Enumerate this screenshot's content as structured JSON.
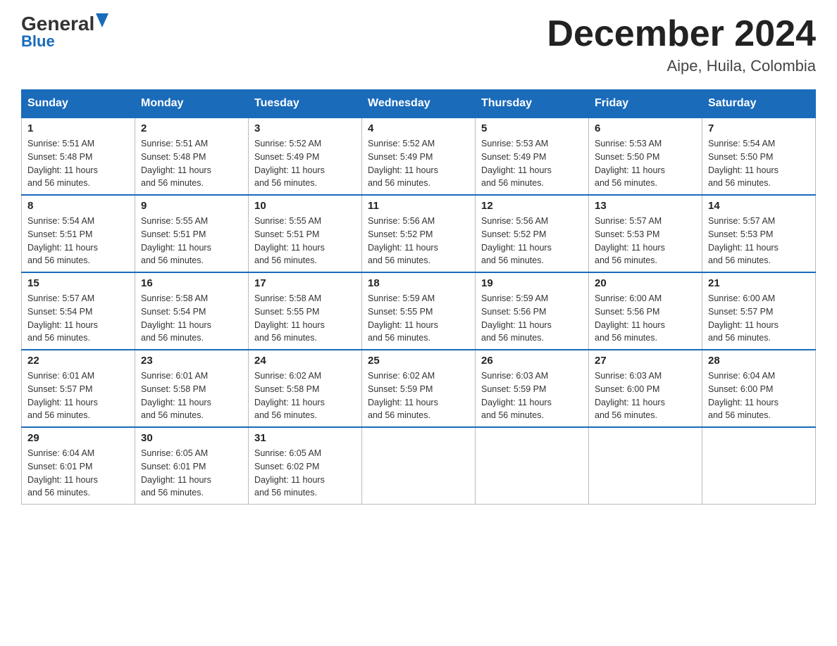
{
  "header": {
    "logo_general": "General",
    "logo_blue": "Blue",
    "month_title": "December 2024",
    "location": "Aipe, Huila, Colombia"
  },
  "weekdays": [
    "Sunday",
    "Monday",
    "Tuesday",
    "Wednesday",
    "Thursday",
    "Friday",
    "Saturday"
  ],
  "weeks": [
    [
      {
        "day": "1",
        "sunrise": "5:51 AM",
        "sunset": "5:48 PM",
        "daylight": "11 hours and 56 minutes."
      },
      {
        "day": "2",
        "sunrise": "5:51 AM",
        "sunset": "5:48 PM",
        "daylight": "11 hours and 56 minutes."
      },
      {
        "day": "3",
        "sunrise": "5:52 AM",
        "sunset": "5:49 PM",
        "daylight": "11 hours and 56 minutes."
      },
      {
        "day": "4",
        "sunrise": "5:52 AM",
        "sunset": "5:49 PM",
        "daylight": "11 hours and 56 minutes."
      },
      {
        "day": "5",
        "sunrise": "5:53 AM",
        "sunset": "5:49 PM",
        "daylight": "11 hours and 56 minutes."
      },
      {
        "day": "6",
        "sunrise": "5:53 AM",
        "sunset": "5:50 PM",
        "daylight": "11 hours and 56 minutes."
      },
      {
        "day": "7",
        "sunrise": "5:54 AM",
        "sunset": "5:50 PM",
        "daylight": "11 hours and 56 minutes."
      }
    ],
    [
      {
        "day": "8",
        "sunrise": "5:54 AM",
        "sunset": "5:51 PM",
        "daylight": "11 hours and 56 minutes."
      },
      {
        "day": "9",
        "sunrise": "5:55 AM",
        "sunset": "5:51 PM",
        "daylight": "11 hours and 56 minutes."
      },
      {
        "day": "10",
        "sunrise": "5:55 AM",
        "sunset": "5:51 PM",
        "daylight": "11 hours and 56 minutes."
      },
      {
        "day": "11",
        "sunrise": "5:56 AM",
        "sunset": "5:52 PM",
        "daylight": "11 hours and 56 minutes."
      },
      {
        "day": "12",
        "sunrise": "5:56 AM",
        "sunset": "5:52 PM",
        "daylight": "11 hours and 56 minutes."
      },
      {
        "day": "13",
        "sunrise": "5:57 AM",
        "sunset": "5:53 PM",
        "daylight": "11 hours and 56 minutes."
      },
      {
        "day": "14",
        "sunrise": "5:57 AM",
        "sunset": "5:53 PM",
        "daylight": "11 hours and 56 minutes."
      }
    ],
    [
      {
        "day": "15",
        "sunrise": "5:57 AM",
        "sunset": "5:54 PM",
        "daylight": "11 hours and 56 minutes."
      },
      {
        "day": "16",
        "sunrise": "5:58 AM",
        "sunset": "5:54 PM",
        "daylight": "11 hours and 56 minutes."
      },
      {
        "day": "17",
        "sunrise": "5:58 AM",
        "sunset": "5:55 PM",
        "daylight": "11 hours and 56 minutes."
      },
      {
        "day": "18",
        "sunrise": "5:59 AM",
        "sunset": "5:55 PM",
        "daylight": "11 hours and 56 minutes."
      },
      {
        "day": "19",
        "sunrise": "5:59 AM",
        "sunset": "5:56 PM",
        "daylight": "11 hours and 56 minutes."
      },
      {
        "day": "20",
        "sunrise": "6:00 AM",
        "sunset": "5:56 PM",
        "daylight": "11 hours and 56 minutes."
      },
      {
        "day": "21",
        "sunrise": "6:00 AM",
        "sunset": "5:57 PM",
        "daylight": "11 hours and 56 minutes."
      }
    ],
    [
      {
        "day": "22",
        "sunrise": "6:01 AM",
        "sunset": "5:57 PM",
        "daylight": "11 hours and 56 minutes."
      },
      {
        "day": "23",
        "sunrise": "6:01 AM",
        "sunset": "5:58 PM",
        "daylight": "11 hours and 56 minutes."
      },
      {
        "day": "24",
        "sunrise": "6:02 AM",
        "sunset": "5:58 PM",
        "daylight": "11 hours and 56 minutes."
      },
      {
        "day": "25",
        "sunrise": "6:02 AM",
        "sunset": "5:59 PM",
        "daylight": "11 hours and 56 minutes."
      },
      {
        "day": "26",
        "sunrise": "6:03 AM",
        "sunset": "5:59 PM",
        "daylight": "11 hours and 56 minutes."
      },
      {
        "day": "27",
        "sunrise": "6:03 AM",
        "sunset": "6:00 PM",
        "daylight": "11 hours and 56 minutes."
      },
      {
        "day": "28",
        "sunrise": "6:04 AM",
        "sunset": "6:00 PM",
        "daylight": "11 hours and 56 minutes."
      }
    ],
    [
      {
        "day": "29",
        "sunrise": "6:04 AM",
        "sunset": "6:01 PM",
        "daylight": "11 hours and 56 minutes."
      },
      {
        "day": "30",
        "sunrise": "6:05 AM",
        "sunset": "6:01 PM",
        "daylight": "11 hours and 56 minutes."
      },
      {
        "day": "31",
        "sunrise": "6:05 AM",
        "sunset": "6:02 PM",
        "daylight": "11 hours and 56 minutes."
      },
      null,
      null,
      null,
      null
    ]
  ]
}
